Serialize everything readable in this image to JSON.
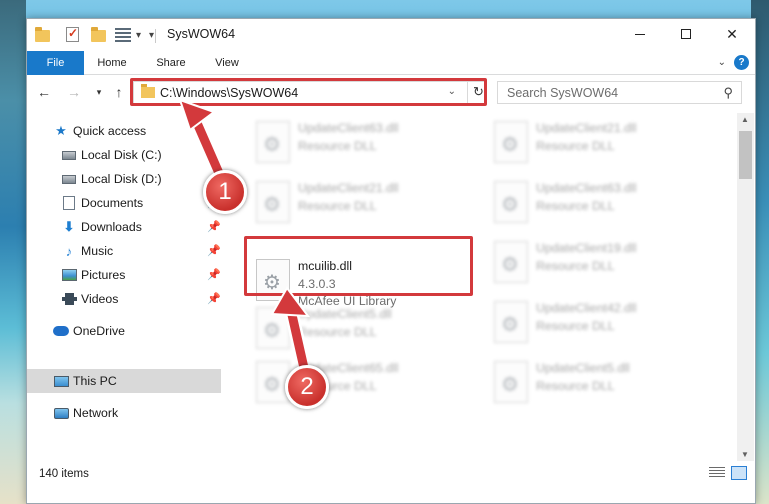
{
  "window": {
    "title": "SysWOW64"
  },
  "ribbon": {
    "tabs": [
      {
        "label": "File"
      },
      {
        "label": "Home"
      },
      {
        "label": "Share"
      },
      {
        "label": "View"
      }
    ]
  },
  "address": {
    "path": "C:\\Windows\\SysWOW64"
  },
  "search": {
    "placeholder": "Search SysWOW64"
  },
  "sidebar": {
    "items": [
      {
        "label": "Quick access"
      },
      {
        "label": "Local Disk (C:)"
      },
      {
        "label": "Local Disk (D:)"
      },
      {
        "label": "Documents"
      },
      {
        "label": "Downloads"
      },
      {
        "label": "Music"
      },
      {
        "label": "Pictures"
      },
      {
        "label": "Videos"
      },
      {
        "label": "OneDrive"
      },
      {
        "label": "This PC"
      },
      {
        "label": "Network"
      }
    ]
  },
  "files": [
    {
      "name": "UpdateClient63.dll",
      "type": "Resource DLL"
    },
    {
      "name": "UpdateClient21.dll",
      "type": "Resource DLL"
    },
    {
      "name": "UpdateClient21.dll",
      "type": "Resource DLL"
    },
    {
      "name": "UpdateClient63.dll",
      "type": "Resource DLL"
    },
    {
      "name": "mcuilib.dll",
      "version": "4.3.0.3",
      "description": "McAfee UI Library"
    },
    {
      "name": "UpdateClient19.dll",
      "type": "Resource DLL"
    },
    {
      "name": "UpdateClient5.dll",
      "type": "Resource DLL"
    },
    {
      "name": "UpdateClient42.dll",
      "type": "Resource DLL"
    },
    {
      "name": "UpdateClient65.dll",
      "type": "Resource DLL"
    },
    {
      "name": "UpdateClient5.dll",
      "type": "Resource DLL"
    }
  ],
  "status": {
    "item_count": "140 items"
  },
  "annotations": {
    "badge1": "1",
    "badge2": "2"
  },
  "colors": {
    "accent": "#1979ca",
    "annotation_red": "#d3393c"
  },
  "icons": [
    "folder-icon",
    "properties-icon",
    "view-options-icon",
    "minimize-icon",
    "maximize-icon",
    "close-icon",
    "help-icon",
    "back-arrow-icon",
    "forward-arrow-icon",
    "up-arrow-icon",
    "refresh-icon",
    "search-icon",
    "dll-file-icon"
  ]
}
